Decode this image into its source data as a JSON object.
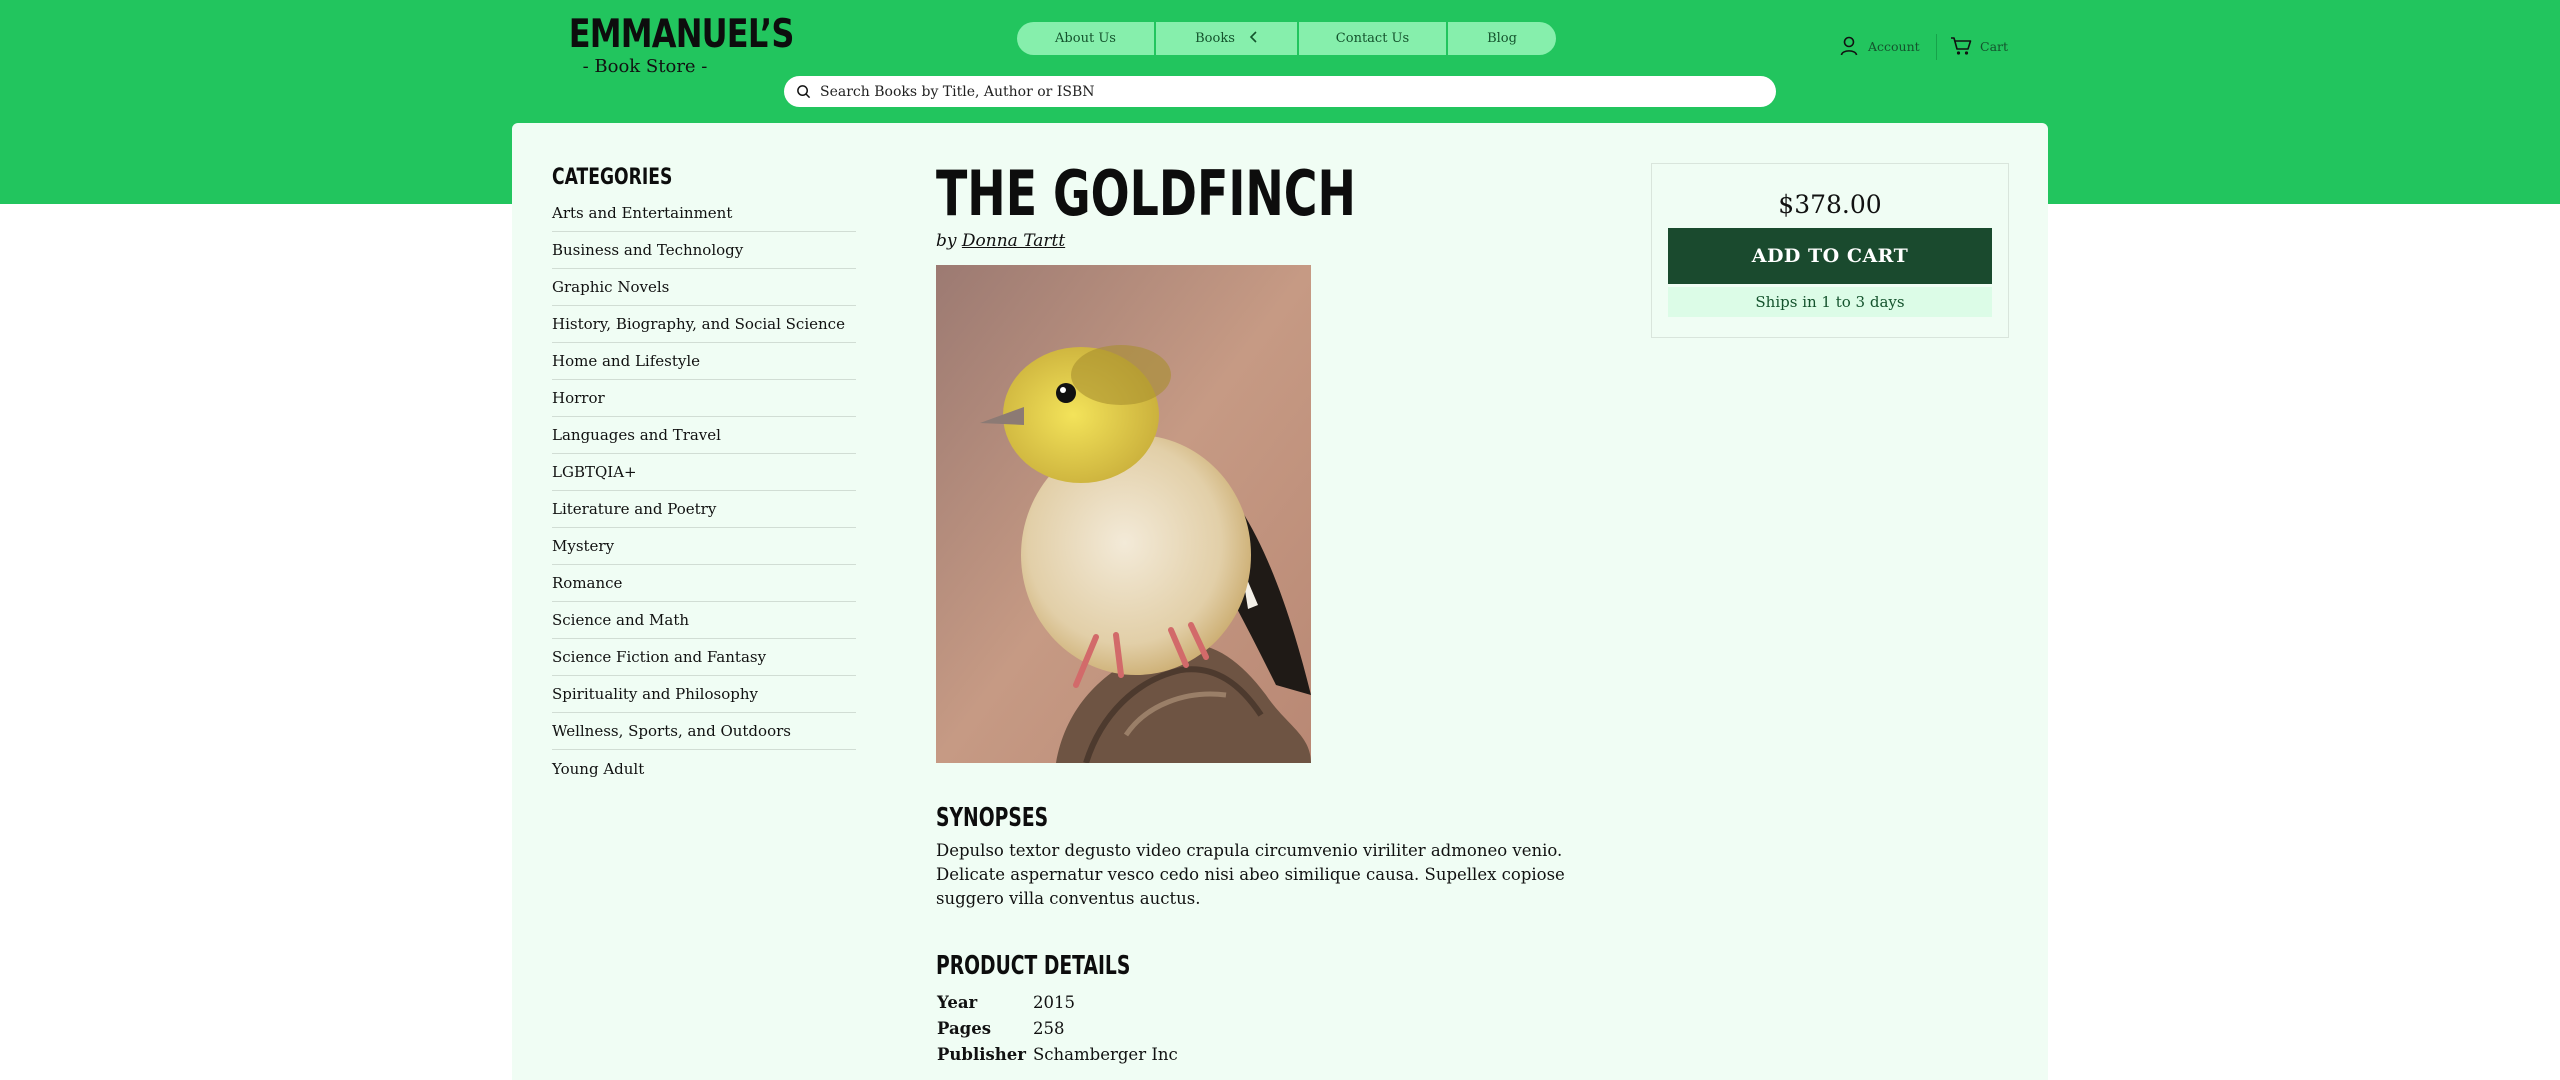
{
  "header": {
    "logo_name": "EMMANUEL’S",
    "logo_sub": "- Book Store -",
    "nav": [
      {
        "label": "About Us"
      },
      {
        "label": "Books"
      },
      {
        "label": "Contact Us"
      },
      {
        "label": "Blog"
      }
    ],
    "search_placeholder": "Search Books by Title, Author or ISBN",
    "account_label": "Account",
    "cart_label": "Cart"
  },
  "sidebar": {
    "title": "CATEGORIES",
    "items": [
      "Arts and Entertainment",
      "Business and Technology",
      "Graphic Novels",
      "History, Biography, and Social Science",
      "Home and Lifestyle",
      "Horror",
      "Languages and Travel",
      "LGBTQIA+",
      "Literature and Poetry",
      "Mystery",
      "Romance",
      "Science and Math",
      "Science Fiction and Fantasy",
      "Spirituality and Philosophy",
      "Wellness, Sports, and Outdoors",
      "Young Adult"
    ]
  },
  "book": {
    "title": "THE GOLDFINCH",
    "by": "by",
    "author": "Donna Tartt",
    "synopsis_heading": "SYNOPSES",
    "synopsis": "Depulso textor degusto video crapula circumvenio viriliter admoneo venio. Delicate aspernatur vesco cedo nisi abeo similique causa. Supellex copiose suggero villa conventus auctus.",
    "details_heading": "PRODUCT DETAILS",
    "details": [
      {
        "key": "Year",
        "value": "2015"
      },
      {
        "key": "Pages",
        "value": "258"
      },
      {
        "key": "Publisher",
        "value": "Schamberger Inc"
      }
    ]
  },
  "buybox": {
    "price": "$378.00",
    "add_to_cart": "ADD TO CART",
    "shipping": "Ships in 1 to 3 days"
  },
  "colors": {
    "brand_green": "#22c55e",
    "panel_bg": "#f0fdf4",
    "button_dark": "#1a4a2e",
    "nav_pill": "#86efac"
  },
  "icons": [
    "search-icon",
    "account-icon",
    "cart-icon",
    "chevron-left-icon"
  ]
}
